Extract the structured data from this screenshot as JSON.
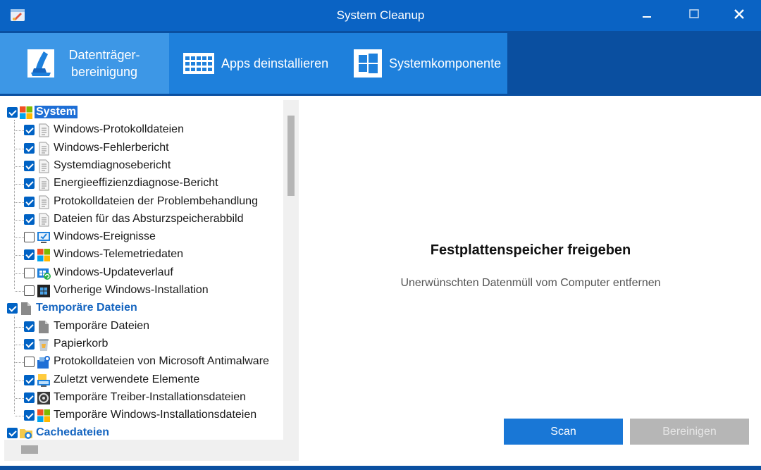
{
  "window": {
    "title": "System Cleanup",
    "colors": {
      "titlebar": "#0a63c4",
      "toolbar": "#0a4fa0",
      "accent": "#1977d6"
    }
  },
  "toolbar": {
    "tabs": [
      {
        "label_line1": "Datenträger-",
        "label_line2": "bereinigung",
        "icon": "broom-disk-icon",
        "active": true
      },
      {
        "label": "Apps deinstallieren",
        "icon": "app-grid-icon"
      },
      {
        "label": "Systemkomponente",
        "icon": "windows-logo-icon"
      }
    ]
  },
  "tree": {
    "categories": [
      {
        "label": "System",
        "checked": true,
        "selected": true,
        "icon": "windows-color-icon",
        "items": [
          {
            "label": "Windows-Protokolldateien",
            "checked": true,
            "icon": "text-file-icon"
          },
          {
            "label": "Windows-Fehlerbericht",
            "checked": true,
            "icon": "text-file-icon"
          },
          {
            "label": "Systemdiagnosebericht",
            "checked": true,
            "icon": "text-file-icon"
          },
          {
            "label": "Energieeffizienzdiagnose-Bericht",
            "checked": true,
            "icon": "text-file-icon"
          },
          {
            "label": "Protokolldateien der Problembehandlung",
            "checked": true,
            "icon": "text-file-icon"
          },
          {
            "label": "Dateien für das Absturzspeicherabbild",
            "checked": true,
            "icon": "text-file-icon"
          },
          {
            "label": "Windows-Ereignisse",
            "checked": false,
            "icon": "monitor-check-icon"
          },
          {
            "label": "Windows-Telemetriedaten",
            "checked": true,
            "icon": "windows-color-icon"
          },
          {
            "label": "Windows-Updateverlauf",
            "checked": false,
            "icon": "update-icon"
          },
          {
            "label": "Vorherige Windows-Installation",
            "checked": false,
            "icon": "windows-dark-icon"
          }
        ]
      },
      {
        "label": "Temporäre Dateien",
        "checked": true,
        "selected": false,
        "icon": "gray-file-icon",
        "items": [
          {
            "label": "Temporäre Dateien",
            "checked": true,
            "icon": "gray-file-icon"
          },
          {
            "label": "Papierkorb",
            "checked": true,
            "icon": "recycle-bin-icon"
          },
          {
            "label": "Protokolldateien von Microsoft Antimalware",
            "checked": false,
            "icon": "antimalware-icon"
          },
          {
            "label": "Zuletzt verwendete Elemente",
            "checked": true,
            "icon": "recent-items-icon"
          },
          {
            "label": "Temporäre Treiber-Installationsdateien",
            "checked": true,
            "icon": "driver-icon"
          },
          {
            "label": "Temporäre Windows-Installationsdateien",
            "checked": true,
            "icon": "windows-color-icon"
          }
        ]
      },
      {
        "label": "Cachedateien",
        "checked": true,
        "selected": false,
        "icon": "cache-icon",
        "items": []
      }
    ]
  },
  "main": {
    "heading": "Festplattenspeicher freigeben",
    "subheading": "Unerwünschten Datenmüll vom Computer entfernen",
    "scan_label": "Scan",
    "clean_label": "Bereinigen"
  }
}
